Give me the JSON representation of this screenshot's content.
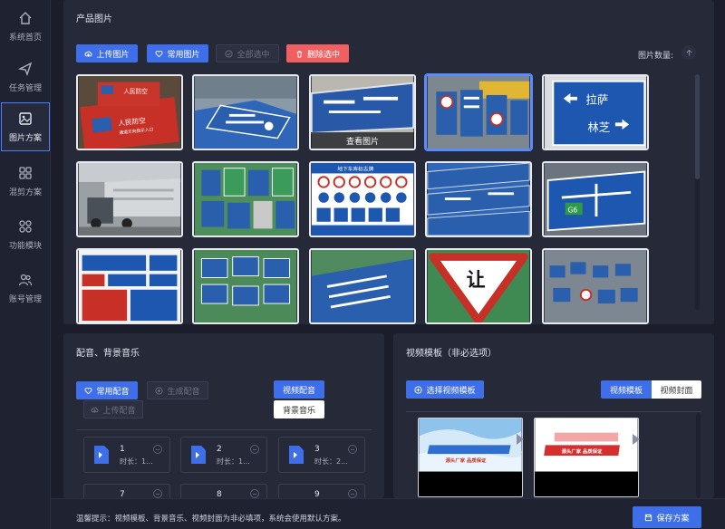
{
  "sidebar": {
    "items": [
      {
        "label": "系统首页",
        "icon": "home-icon"
      },
      {
        "label": "任务管理",
        "icon": "send-icon"
      },
      {
        "label": "图片方案",
        "icon": "image-icon",
        "active": true
      },
      {
        "label": "混剪方案",
        "icon": "grid-icon"
      },
      {
        "label": "功能模块",
        "icon": "modules-icon"
      },
      {
        "label": "账号管理",
        "icon": "users-icon"
      }
    ]
  },
  "images_panel": {
    "title": "产品图片",
    "upload_label": "上传图片",
    "common_label": "常用图片",
    "select_all_label": "全部选中",
    "delete_label": "删除选中",
    "count_label": "图片数量:",
    "view_label": "查看图片",
    "sign_texts": {
      "red_sign_line1": "人民防空",
      "red_sign_line2": "人民防空",
      "red_sign_sub": "通道方向指示入口",
      "blue_sign_line1": "拉萨",
      "blue_sign_line2": "林芝",
      "yield_text": "让",
      "g6_text": "G6",
      "sign_header": "地下车库标志牌"
    }
  },
  "audio_panel": {
    "title": "配音、背景音乐",
    "common_label": "常用配音",
    "generate_label": "生成配音",
    "upload_label": "上传配音",
    "tab_voice": "视频配音",
    "tab_music": "背景音乐",
    "cards": [
      {
        "num": "1",
        "dur": "时长：1..."
      },
      {
        "num": "2",
        "dur": "时长：1..."
      },
      {
        "num": "3",
        "dur": "时长：2..."
      },
      {
        "num": "7",
        "dur": ""
      },
      {
        "num": "8",
        "dur": ""
      },
      {
        "num": "9",
        "dur": ""
      }
    ]
  },
  "template_panel": {
    "title": "视频模板（非必选项）",
    "choose_label": "选择视频模板",
    "seg_template": "视频模板",
    "seg_cover": "视频封面",
    "tpl1_text": "源头厂家 品质保证",
    "tpl2_text": "源头厂家 品质保证"
  },
  "footer": {
    "tip": "温馨提示：视频模板、背景音乐、视频封面为非必填项，系统会使用默认方案。",
    "save_label": "保存方案"
  },
  "colors": {
    "accent": "#3f6fe8",
    "danger": "#f06060",
    "background": "#1b1e2a",
    "panel": "#252938"
  }
}
